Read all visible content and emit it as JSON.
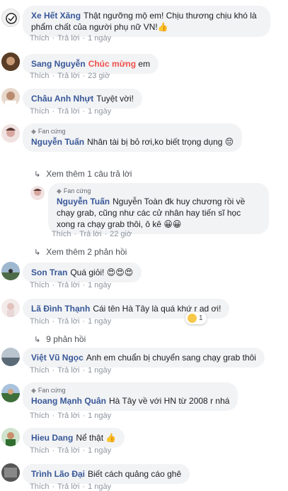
{
  "comments": [
    {
      "name": "Xe Hết Xăng",
      "text": "Thật ngưỡng mộ em! Chịu thương chịu khó là phẩm chất của người phụ nữ VN!👍",
      "like": "Thích",
      "reply": "Trả lời",
      "time": "1 ngày",
      "avatar_color": "#e8e8e8"
    },
    {
      "name": "Sang Nguyễn",
      "highlight": "Chúc mừng",
      "text": "em",
      "like": "Thích",
      "reply": "Trả lời",
      "time": "23 giờ",
      "avatar_color": "#7a5a3a"
    },
    {
      "name": "Châu Anh Nhựt",
      "text": "Tuyệt vời!",
      "like": "Thích",
      "reply": "Trả lời",
      "time": "1 ngày",
      "avatar_color": "#c9a48c"
    },
    {
      "badge": "Fan cứng",
      "name": "Nguyễn Tuấn",
      "text": "Nhân tài bị bỏ rơi,ko biết trọng dụng 😔",
      "more": "Xem thêm 1 câu trả lời",
      "avatar_color": "#d9b7b4"
    },
    {
      "badge": "Fan cứng",
      "name": "Nguyễn Tuấn",
      "text": "Nguyễn Toàn đk huy chương rồi về chạy grab, cũng như các cử nhân hay tiến sĩ học xong ra chạy grab thôi, ô kê 😀😀",
      "like": "Thích",
      "reply": "Trả lời",
      "time": "22 giờ",
      "more": "Xem thêm 2 phản hồi",
      "avatar_color": "#d9b7b4"
    },
    {
      "name": "Son Tran",
      "text": "Quá giỏi! 😍😍😍",
      "like": "Thích",
      "reply": "Trả lời",
      "time": "1 ngày",
      "avatar_color": "#6f8ca8"
    },
    {
      "name": "Lã Đình Thạnh",
      "text": "Cái tên Hà Tây là quá khứ r ad ơi!",
      "reaction_count": "1",
      "like": "Thích",
      "reply": "Trả lời",
      "time": "1 ngày",
      "more": "9 phản hồi",
      "avatar_color": "#e4c9c9"
    },
    {
      "name": "Việt Vũ Ngọc",
      "text": "Anh em chuẩn bị chuyển sang chạy grab thôi",
      "like": "Thích",
      "reply": "Trả lời",
      "time": "1 ngày",
      "avatar_color": "#8a96a3"
    },
    {
      "badge": "Fan cứng",
      "name": "Hoang Mạnh Quân",
      "text": "Hà Tây về với HN từ 2008 r nhá",
      "like": "Thích",
      "reply": "Trả lời",
      "time": "1 ngày",
      "avatar_color": "#5f7d56"
    },
    {
      "name": "Hieu Dang",
      "text": "Nể thật 👍",
      "like": "Thích",
      "reply": "Trả lời",
      "time": "1 ngày",
      "avatar_color": "#4c7f4c"
    },
    {
      "name": "Trình Lão Đại",
      "text": "Biết cách quảng cáo ghê",
      "like": "Thích",
      "reply": "Trả lời",
      "time": "1 ngày",
      "avatar_color": "#4a4a4a"
    }
  ],
  "colors": {
    "name": "#385898",
    "bubble": "#f2f3f5",
    "meta": "#8d949e",
    "highlight": "#f0514c"
  }
}
